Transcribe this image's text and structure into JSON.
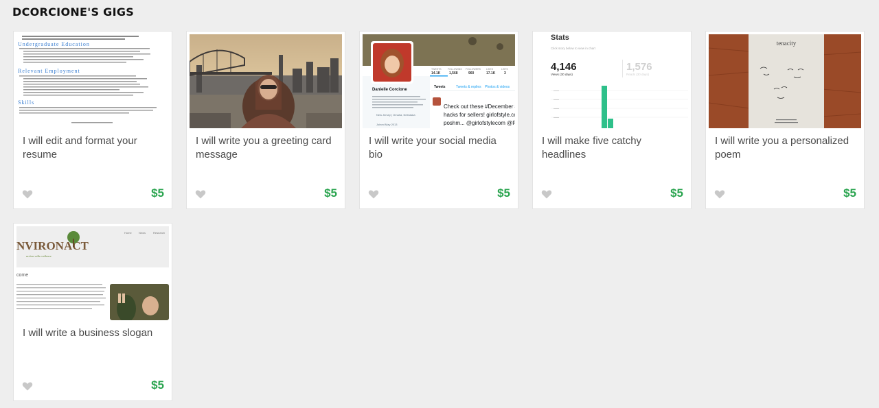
{
  "section": {
    "title": "DCORCIONE'S GIGS"
  },
  "gigs": [
    {
      "title": "I will edit and format your resume",
      "price": "$5",
      "thumb": {
        "heading1": "Undergraduate Education",
        "heading2": "Relevant Employment",
        "heading3": "Skills"
      }
    },
    {
      "title": "I will write you a greeting card message",
      "price": "$5"
    },
    {
      "title": "I will write your social media bio",
      "price": "$5",
      "thumb": {
        "name": "Danielle Corcione",
        "tab_tweets": "Tweets",
        "tab_replies": "Tweets & replies",
        "tab_photos": "Photos & videos",
        "stats": [
          "14.1K",
          "1,568",
          "960",
          "17.1K",
          "3"
        ],
        "stat_labels": [
          "TWEETS",
          "FOLLOWING",
          "FOLLOWERS",
          "LIKES",
          "LISTS"
        ],
        "tweet_line1": "Check out these #December #",
        "tweet_line2": "hacks for sellers! girlofstyle.com",
        "tweet_line3": "poshm... @girlofstylecom @Po",
        "location": "New Jersey | Omaha, Nebraska",
        "joined": "Joined May 2013"
      }
    },
    {
      "title": "I will make five catchy headlines",
      "price": "$5",
      "thumb": {
        "heading": "Stats",
        "hint": "Click story below to view in chart",
        "views": "4,146",
        "views_label": "Views (30 days)",
        "reads": "1,576",
        "reads_label": "Reads (30 days)"
      }
    },
    {
      "title": "I will write you a personalized poem",
      "price": "$5",
      "thumb": {
        "poem_title": "tenacity"
      }
    },
    {
      "title": "I will write a business slogan",
      "price": "$5",
      "thumb": {
        "logo": "NVIRONACT",
        "tagline": "action with evidence",
        "nav": [
          "Home",
          "News",
          "Research"
        ],
        "welcome": "come"
      }
    }
  ],
  "colors": {
    "price": "#2aa44f",
    "background": "#eeeeee",
    "heart": "#c8c8c8"
  },
  "icons": {
    "favorite": "heart-icon"
  }
}
